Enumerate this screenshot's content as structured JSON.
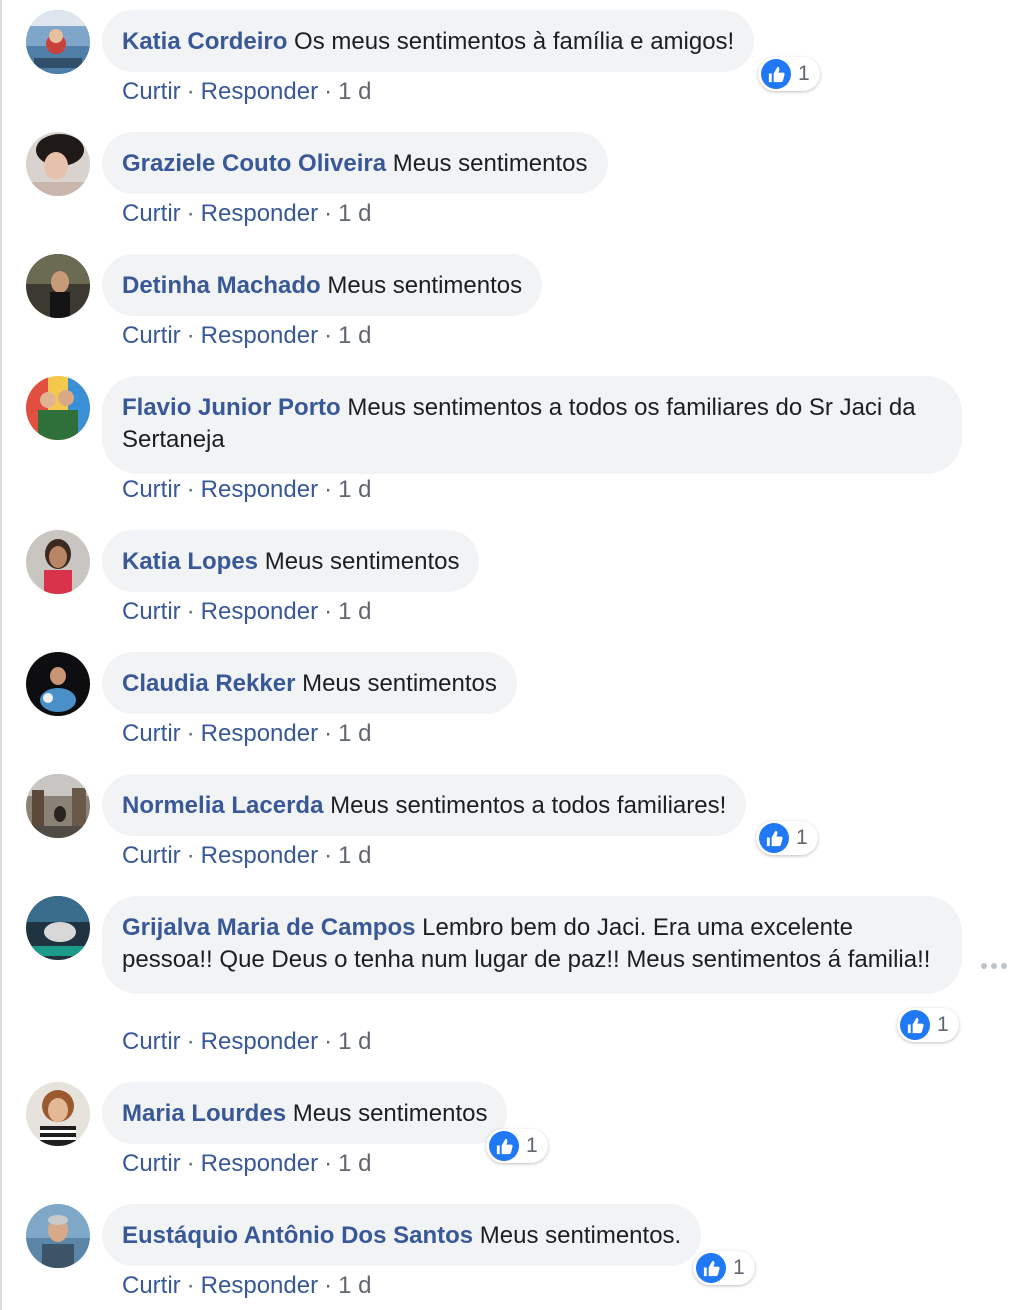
{
  "like_color": "#2078f4",
  "link_color": "#385898",
  "comments": [
    {
      "author": "Katia Cordeiro",
      "text": "Os meus sentimentos à família e amigos!",
      "like": "Curtir",
      "reply": "Responder",
      "time": "1 d",
      "reactions": "1"
    },
    {
      "author": "Graziele Couto Oliveira",
      "text": "Meus sentimentos",
      "like": "Curtir",
      "reply": "Responder",
      "time": "1 d"
    },
    {
      "author": "Detinha Machado",
      "text": "Meus sentimentos",
      "like": "Curtir",
      "reply": "Responder",
      "time": "1 d"
    },
    {
      "author": "Flavio Junior Porto",
      "text": "Meus sentimentos a todos os familiares do Sr Jaci da Sertaneja",
      "like": "Curtir",
      "reply": "Responder",
      "time": "1 d"
    },
    {
      "author": "Katia Lopes",
      "text": "Meus sentimentos",
      "like": "Curtir",
      "reply": "Responder",
      "time": "1 d"
    },
    {
      "author": "Claudia Rekker",
      "text": "Meus sentimentos",
      "like": "Curtir",
      "reply": "Responder",
      "time": "1 d"
    },
    {
      "author": "Normelia Lacerda",
      "text": "Meus sentimentos a todos familiares!",
      "like": "Curtir",
      "reply": "Responder",
      "time": "1 d",
      "reactions": "1"
    },
    {
      "author": "Grijalva Maria de Campos",
      "text": "Lembro bem do Jaci. Era uma excelente pessoa!! Que Deus o tenha num lugar de paz!! Meus sentimentos á familia!!",
      "like": "Curtir",
      "reply": "Responder",
      "time": "1 d",
      "reactions": "1"
    },
    {
      "author": "Maria Lourdes",
      "text": "Meus sentimentos",
      "like": "Curtir",
      "reply": "Responder",
      "time": "1 d",
      "reactions": "1"
    },
    {
      "author": "Eustáquio Antônio Dos Santos",
      "text": "Meus sentimentos.",
      "like": "Curtir",
      "reply": "Responder",
      "time": "1 d",
      "reactions": "1"
    }
  ],
  "separator": "·",
  "icons": {
    "like": "thumbs-up-icon",
    "more": "more-options-icon"
  }
}
